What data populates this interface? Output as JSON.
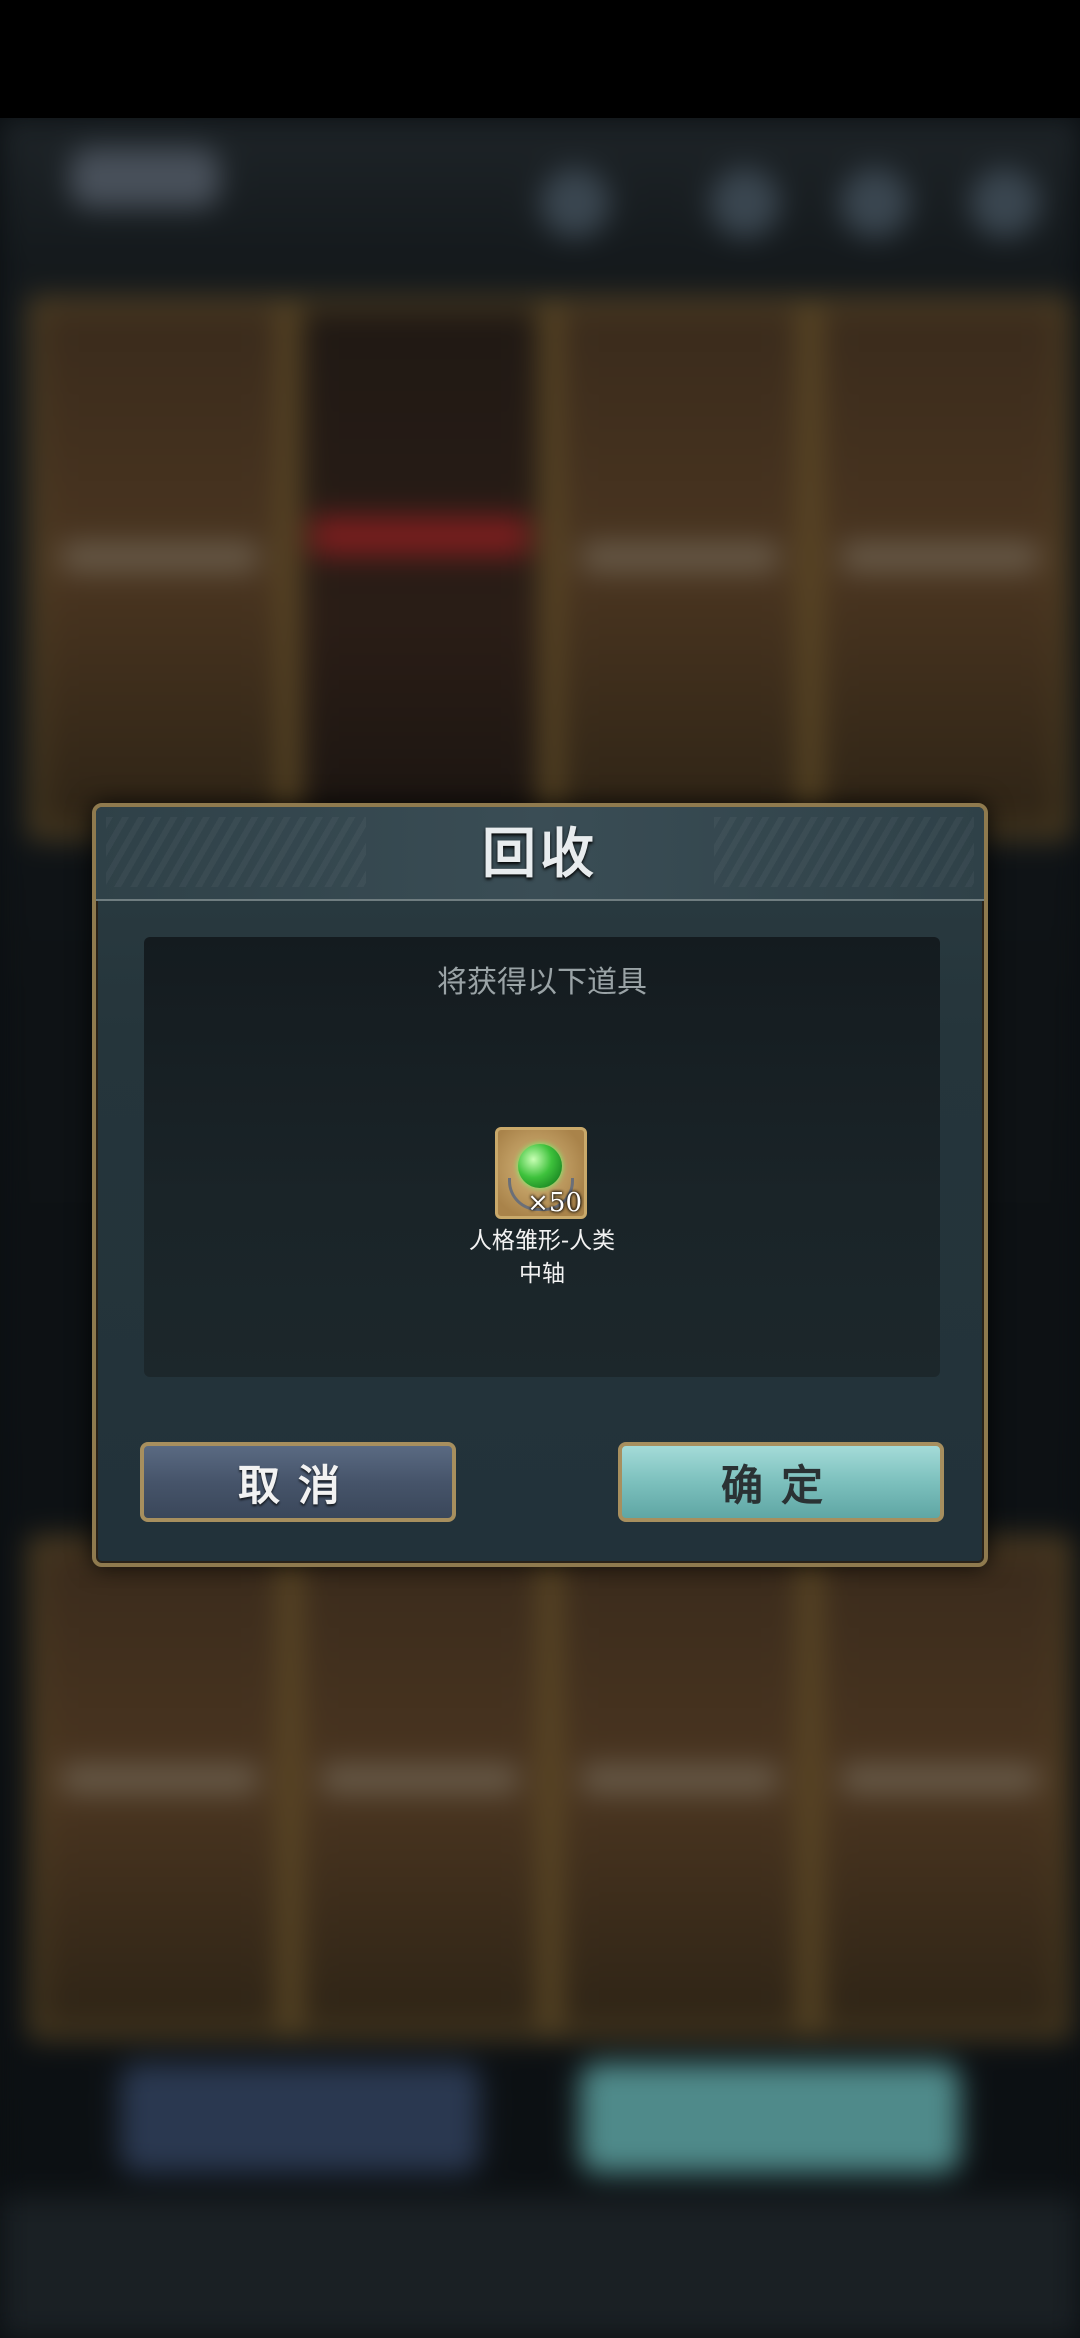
{
  "dialog": {
    "title": "回收",
    "caption": "将获得以下道具",
    "items": [
      {
        "name": "人格雏形-人类中轴",
        "count": "×50",
        "icon": "green-gem-icon"
      }
    ],
    "cancel_label": "取消",
    "confirm_label": "确定"
  },
  "colors": {
    "cancel_button": "#4a5870",
    "confirm_button": "#7cc0bd",
    "frame_gold": "#8f7a4e"
  }
}
